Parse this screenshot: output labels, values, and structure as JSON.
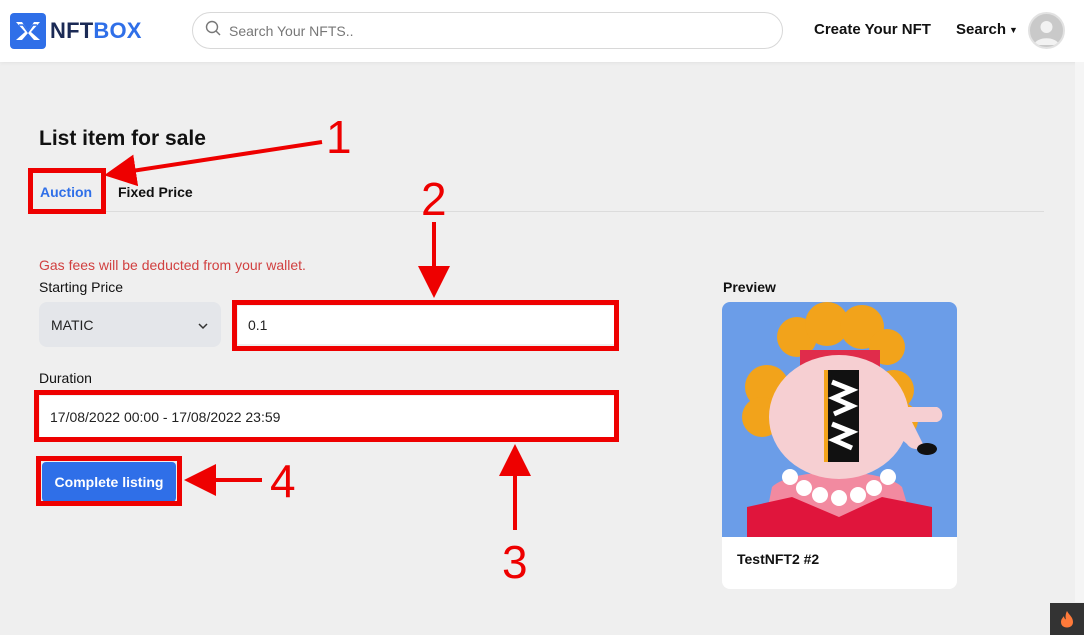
{
  "header": {
    "logo_text_a": "NFT",
    "logo_text_b": "BOX",
    "search_placeholder": "Search Your NFTS..",
    "nav_create": "Create Your NFT",
    "nav_search": "Search"
  },
  "main": {
    "title": "List item for sale",
    "tabs": [
      {
        "label": "Auction",
        "active": true
      },
      {
        "label": "Fixed Price",
        "active": false
      }
    ],
    "gas_notice": "Gas fees will be deducted from your wallet.",
    "starting_price_label": "Starting Price",
    "currency": "MATIC",
    "price_value": "0.1",
    "duration_label": "Duration",
    "duration_value": "17/08/2022 00:00 - 17/08/2022 23:59",
    "complete_button": "Complete listing"
  },
  "preview": {
    "label": "Preview",
    "nft_name": "TestNFT2 #2"
  },
  "annotations": {
    "n1": "1",
    "n2": "2",
    "n3": "3",
    "n4": "4"
  },
  "colors": {
    "accent": "#2f6fe8",
    "annotation": "#ee0000",
    "warning": "#d14040"
  },
  "icons": [
    "nftbox-logo-icon",
    "search-icon",
    "caret-down-icon",
    "avatar-icon",
    "chevron-down-icon",
    "fire-icon"
  ]
}
